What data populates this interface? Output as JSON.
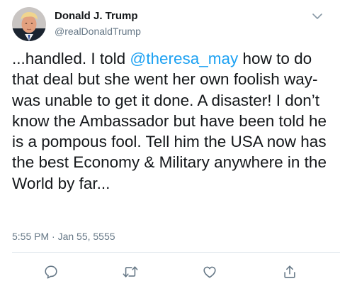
{
  "tweet": {
    "author": {
      "display_name": "Donald J. Trump",
      "handle": "@realDonaldTrump",
      "avatar_icon": "profile-photo"
    },
    "text_before": "...handled. I told ",
    "mention": "@theresa_may",
    "text_after": " how to do that deal but she went her own foolish way-was unable to get it done. A disaster! I don’t know the Ambassador but have been told he is a pompous fool. Tell him the USA now has the best Economy & Military anywhere in the World by far...",
    "timestamp": "5:55 PM · Jan 55, 5555"
  },
  "actions": {
    "reply_icon": "reply-icon",
    "retweet_icon": "retweet-icon",
    "like_icon": "like-icon",
    "share_icon": "share-icon"
  },
  "colors": {
    "link": "#1da1f2",
    "secondary_text": "#657786",
    "primary_text": "#14171a",
    "icon": "#657786"
  }
}
